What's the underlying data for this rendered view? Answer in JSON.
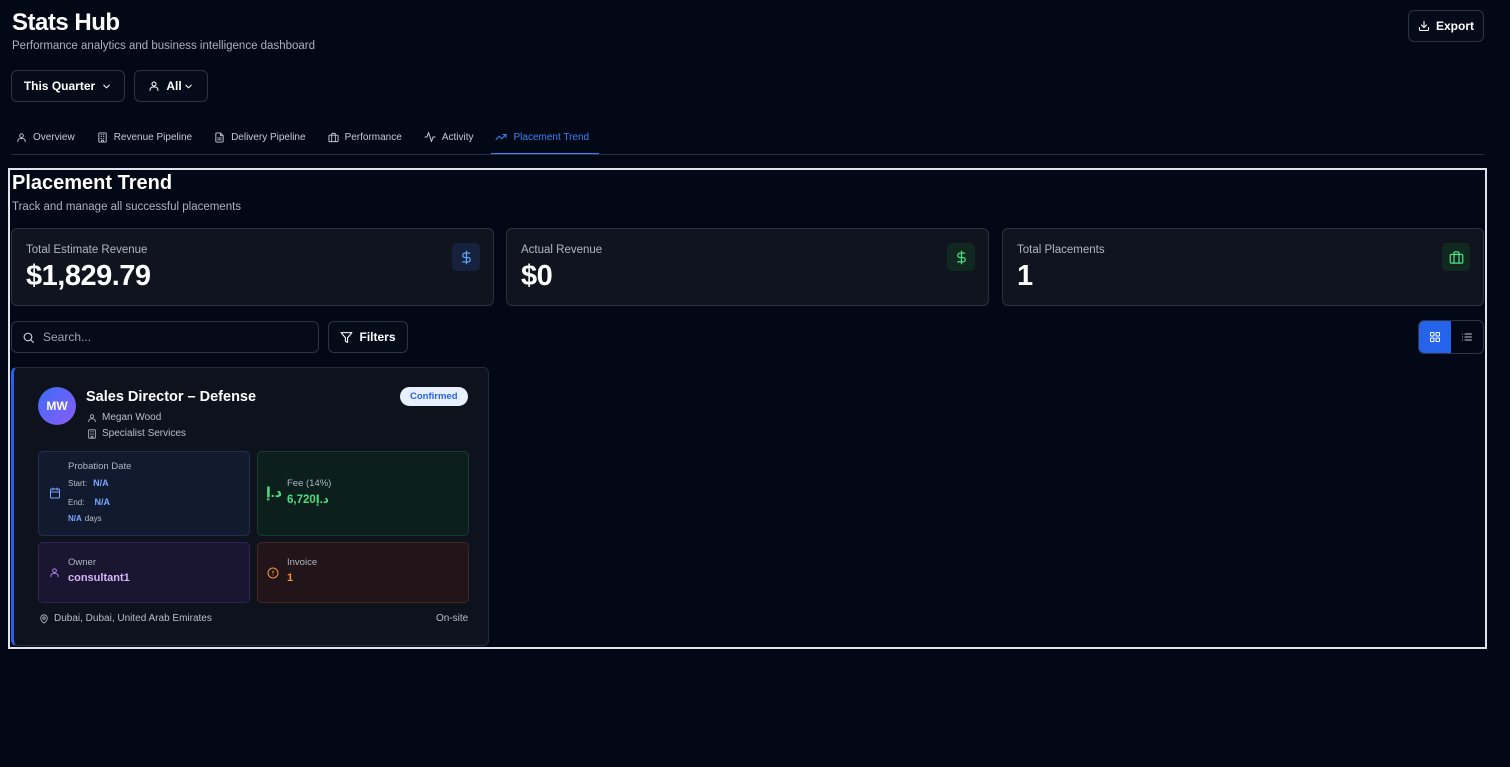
{
  "header": {
    "title": "Stats Hub",
    "subtitle": "Performance analytics and business intelligence dashboard",
    "export_label": "Export"
  },
  "filters_bar": {
    "period_label": "This Quarter",
    "scope_label": "All"
  },
  "tabs": [
    {
      "label": "Overview",
      "icon": "user-icon"
    },
    {
      "label": "Revenue Pipeline",
      "icon": "building-icon"
    },
    {
      "label": "Delivery Pipeline",
      "icon": "document-icon"
    },
    {
      "label": "Performance",
      "icon": "briefcase-icon"
    },
    {
      "label": "Activity",
      "icon": "activity-icon"
    },
    {
      "label": "Placement Trend",
      "icon": "trending-up-icon",
      "active": true
    }
  ],
  "section": {
    "title": "Placement Trend",
    "subtitle": "Track and manage all successful placements"
  },
  "stats": [
    {
      "label": "Total Estimate Revenue",
      "value": "$1,829.79",
      "icon": "dollar-icon",
      "color": "#60a5fa"
    },
    {
      "label": "Actual Revenue",
      "value": "$0",
      "icon": "dollar-icon",
      "color": "#4ade80"
    },
    {
      "label": "Total Placements",
      "value": "1",
      "icon": "briefcase-icon",
      "color": "#4ade80"
    }
  ],
  "search": {
    "placeholder": "Search..."
  },
  "filters_label": "Filters",
  "view_mode": "grid",
  "placement": {
    "initials": "MW",
    "title": "Sales Director – Defense",
    "candidate": "Megan Wood",
    "company": "Specialist Services",
    "status": "Confirmed",
    "probation": {
      "label": "Probation Date",
      "start_label": "Start:",
      "start_value": "N/A",
      "end_label": "End:",
      "end_value": "N/A",
      "days_value": "N/A",
      "days_label": "days"
    },
    "fee": {
      "label": "Fee (14%)",
      "currency_symbol": "د.إ",
      "value": "6,720د.إ"
    },
    "owner": {
      "label": "Owner",
      "value": "consultant1"
    },
    "invoice": {
      "label": "Invoice",
      "value": "1"
    },
    "location": "Dubai, Dubai, United Arab Emirates",
    "work_mode": "On-site"
  }
}
